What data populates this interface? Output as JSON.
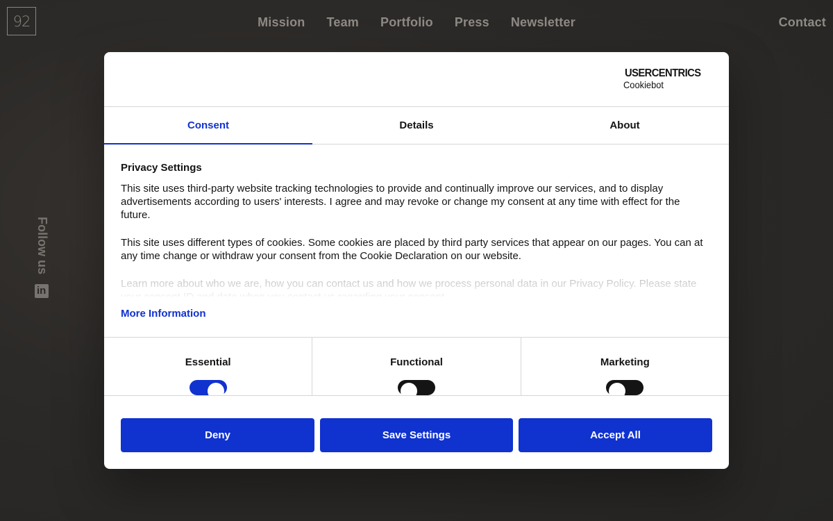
{
  "site": {
    "logo": "92",
    "nav": [
      "Mission",
      "Team",
      "Portfolio",
      "Press",
      "Newsletter"
    ],
    "contact": "Contact",
    "follow_us": "Follow us",
    "social_icon": "linkedin-icon"
  },
  "dialog": {
    "brand": {
      "name": "USERCENTRICS",
      "sub": "Cookiebot",
      "icon": "shield-icon"
    },
    "tabs": [
      {
        "label": "Consent",
        "active": true
      },
      {
        "label": "Details",
        "active": false
      },
      {
        "label": "About",
        "active": false
      }
    ],
    "title": "Privacy Settings",
    "paragraphs": [
      "This site uses third-party website tracking technologies to provide and continually improve our services, and to display advertisements according to users' interests. I agree and may revoke or change my consent at any time with effect for the future.",
      "This site uses different types of cookies. Some cookies are placed by third party services that appear on our pages. You can at any time change or withdraw your consent from the Cookie Declaration on our website.",
      "Learn more about who we are, how you can contact us and how we process personal data in our Privacy Policy. Please state your consent ID and date when you contact us regarding your consent."
    ],
    "more_info": "More Information",
    "categories": [
      {
        "label": "Essential",
        "state": "on"
      },
      {
        "label": "Functional",
        "state": "off"
      },
      {
        "label": "Marketing",
        "state": "off"
      }
    ],
    "buttons": {
      "deny": "Deny",
      "save": "Save Settings",
      "accept": "Accept All"
    },
    "colors": {
      "accent": "#1032cf",
      "toggle_off": "#141414"
    }
  }
}
